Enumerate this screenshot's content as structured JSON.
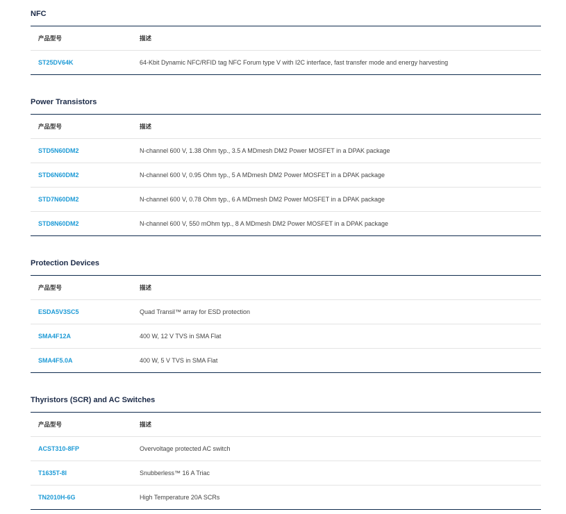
{
  "sections": [
    {
      "title": "NFC",
      "header": {
        "part": "产品型号",
        "desc": "描述"
      },
      "rows": [
        {
          "part": "ST25DV64K",
          "desc": "64-Kbit Dynamic NFC/RFID tag NFC Forum type V with I2C interface, fast transfer mode and energy harvesting"
        }
      ]
    },
    {
      "title": "Power Transistors",
      "header": {
        "part": "产品型号",
        "desc": "描述"
      },
      "rows": [
        {
          "part": "STD5N60DM2",
          "desc": "N-channel 600 V, 1.38 Ohm typ., 3.5 A MDmesh DM2 Power MOSFET in a DPAK package"
        },
        {
          "part": "STD6N60DM2",
          "desc": "N-channel 600 V, 0.95 Ohm typ., 5 A MDmesh DM2 Power MOSFET in a DPAK package"
        },
        {
          "part": "STD7N60DM2",
          "desc": "N-channel 600 V, 0.78 Ohm typ., 6 A MDmesh DM2 Power MOSFET in a DPAK package"
        },
        {
          "part": "STD8N60DM2",
          "desc": "N-channel 600 V, 550 mOhm typ., 8 A MDmesh DM2 Power MOSFET in a DPAK package"
        }
      ]
    },
    {
      "title": "Protection Devices",
      "header": {
        "part": "产品型号",
        "desc": "描述"
      },
      "rows": [
        {
          "part": "ESDA5V3SC5",
          "desc": "Quad Transil™ array for ESD protection"
        },
        {
          "part": "SMA4F12A",
          "desc": "400 W, 12 V TVS in SMA Flat"
        },
        {
          "part": "SMA4F5.0A",
          "desc": "400 W, 5 V TVS in SMA Flat"
        }
      ]
    },
    {
      "title": "Thyristors (SCR) and AC Switches",
      "header": {
        "part": "产品型号",
        "desc": "描述"
      },
      "rows": [
        {
          "part": "ACST310-8FP",
          "desc": "Overvoltage protected AC switch"
        },
        {
          "part": "T1635T-8I",
          "desc": "Snubberless™ 16 A Triac"
        },
        {
          "part": "TN2010H-6G",
          "desc": "High Temperature 20A SCRs"
        }
      ]
    }
  ],
  "colors": {
    "accent": "#1d9ad6",
    "rule": "#0e2a4d",
    "title": "#1b2a47"
  }
}
